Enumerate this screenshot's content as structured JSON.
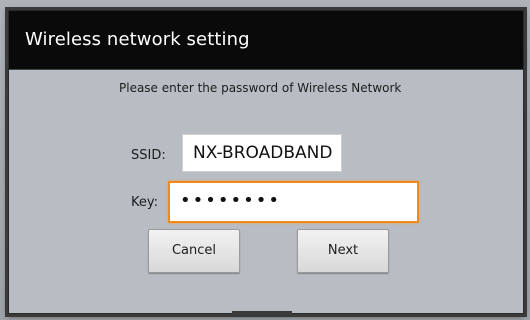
{
  "dialog": {
    "title": "Wireless network setting",
    "instruction": "Please enter the password of Wireless Network",
    "ssid_label": "SSID:",
    "ssid_value": "NX-BROADBAND",
    "key_label": "Key:",
    "key_value_masked": "••••••••",
    "cancel_label": "Cancel",
    "next_label": "Next"
  },
  "colors": {
    "title_bar": "#0a0a0a",
    "dialog_body": "#b7bdc3",
    "focus_border": "#f08a1c"
  }
}
